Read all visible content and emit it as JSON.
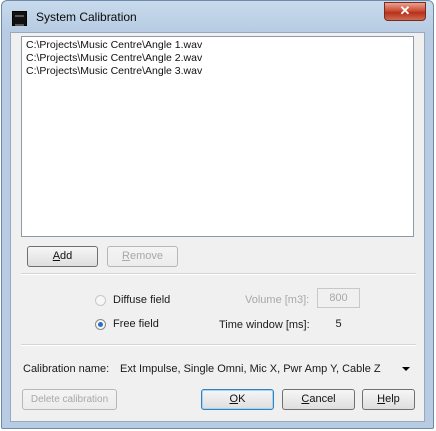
{
  "window": {
    "title": "System Calibration",
    "close_glyph": "✕"
  },
  "files": [
    "C:\\Projects\\Music Centre\\Angle 1.wav",
    "C:\\Projects\\Music Centre\\Angle 2.wav",
    "C:\\Projects\\Music Centre\\Angle 3.wav"
  ],
  "list_buttons": {
    "add": {
      "accel": "A",
      "rest": "dd"
    },
    "remove": {
      "accel": "R",
      "rest": "emove"
    }
  },
  "field_type": {
    "diffuse": "Diffuse field",
    "free": "Free field",
    "selected": "free"
  },
  "volume": {
    "label": "Volume [m3]:",
    "value": "800"
  },
  "time_window": {
    "label": "Time window [ms]:",
    "value": "5"
  },
  "calibration": {
    "label": "Calibration name:",
    "value": "Ext Impulse, Single Omni, Mic X, Pwr Amp Y, Cable Z"
  },
  "bottom_buttons": {
    "delete": "Delete calibration",
    "ok": {
      "accel": "O",
      "rest": "K"
    },
    "cancel": {
      "accel": "C",
      "rest": "ancel"
    },
    "help": {
      "accel": "H",
      "rest": "elp"
    }
  },
  "icons": {
    "app": "app-icon",
    "close": "close-icon",
    "dropdown": "chevron-down-icon"
  }
}
